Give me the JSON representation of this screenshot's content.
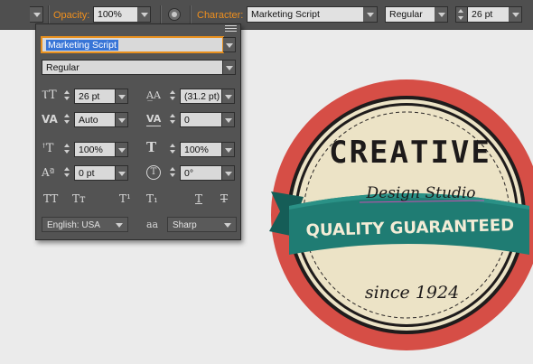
{
  "control_bar": {
    "opacity_label": "Opacity:",
    "opacity_value": "100%",
    "character_label": "Character:",
    "font_family": "Marketing Script",
    "font_style": "Regular",
    "font_size": "26 pt"
  },
  "panel": {
    "font_family": "Marketing Script",
    "font_style": "Regular",
    "font_size": "26 pt",
    "leading": "(31.2 pt)",
    "kerning": "Auto",
    "tracking": "0",
    "vertical_scale": "100%",
    "horizontal_scale": "100%",
    "baseline_shift": "0 pt",
    "rotation": "0°",
    "type_buttons": [
      "TT",
      "Tт",
      "T¹",
      "T₁",
      "T",
      "T"
    ],
    "language": "English: USA",
    "antialias_icon_text": "aa",
    "antialias": "Sharp"
  },
  "badge": {
    "title": "CREATIVE",
    "subtitle": "Design Studio",
    "ribbon": "QUALITY GUARANTEED",
    "since": "since 1924"
  },
  "colors": {
    "orange_label": "#f0901e",
    "badge_red": "#d64e46",
    "badge_cream": "#ece3c6",
    "ribbon_teal": "#1f7c73"
  }
}
